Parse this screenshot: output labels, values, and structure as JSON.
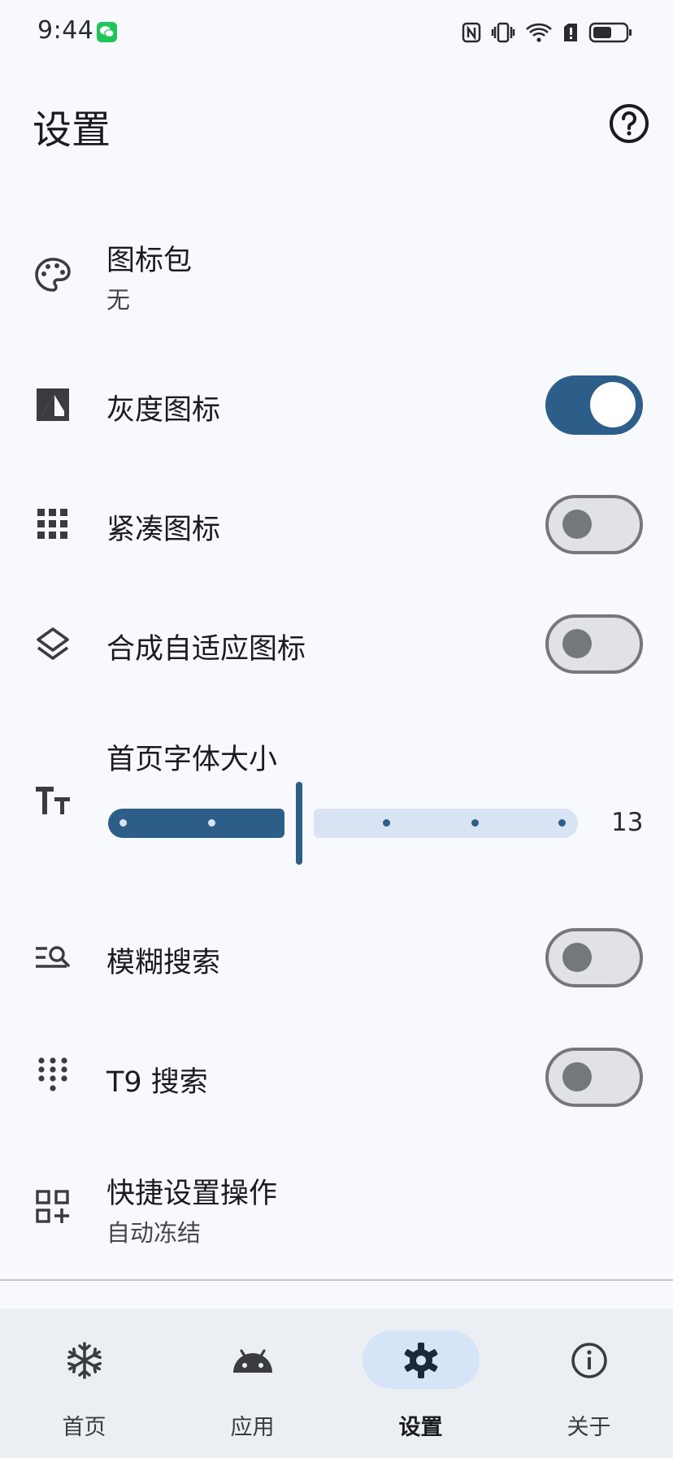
{
  "status_bar": {
    "time": "9:44",
    "notification_icons": [
      "wechat-icon"
    ],
    "system_icons": [
      "nfc-icon",
      "vibrate-icon",
      "wifi-icon",
      "sim-alert-icon",
      "battery-icon"
    ]
  },
  "header": {
    "title": "设置",
    "help_icon": "help-circle-icon"
  },
  "settings": {
    "icon_pack": {
      "title": "图标包",
      "value": "无",
      "icon": "palette-icon"
    },
    "grayscale_icons": {
      "title": "灰度图标",
      "enabled": true,
      "icon": "contrast-icon"
    },
    "compact_icons": {
      "title": "紧凑图标",
      "enabled": false,
      "icon": "grid-icon"
    },
    "adaptive_icons": {
      "title": "合成自适应图标",
      "enabled": false,
      "icon": "layers-icon"
    },
    "home_font_size": {
      "title": "首页字体大小",
      "value": "13",
      "icon": "text-size-icon"
    },
    "fuzzy_search": {
      "title": "模糊搜索",
      "enabled": false,
      "icon": "search-list-icon"
    },
    "t9_search": {
      "title": "T9 搜索",
      "enabled": false,
      "icon": "dialpad-icon"
    },
    "quick_settings": {
      "title": "快捷设置操作",
      "value": "自动冻结",
      "icon": "add-widget-icon"
    }
  },
  "bottom_nav": {
    "items": [
      {
        "label": "首页",
        "icon": "snowflake-icon",
        "active": false
      },
      {
        "label": "应用",
        "icon": "android-icon",
        "active": false
      },
      {
        "label": "设置",
        "icon": "gear-icon",
        "active": true
      },
      {
        "label": "关于",
        "icon": "info-icon",
        "active": false
      }
    ]
  },
  "colors": {
    "primary": "#2d5d89",
    "background": "#f7f9fd",
    "nav_background": "#ebeef3",
    "active_pill": "#d6e4f7",
    "track_inactive": "#d8e3f4",
    "wechat": "#22c35b"
  }
}
